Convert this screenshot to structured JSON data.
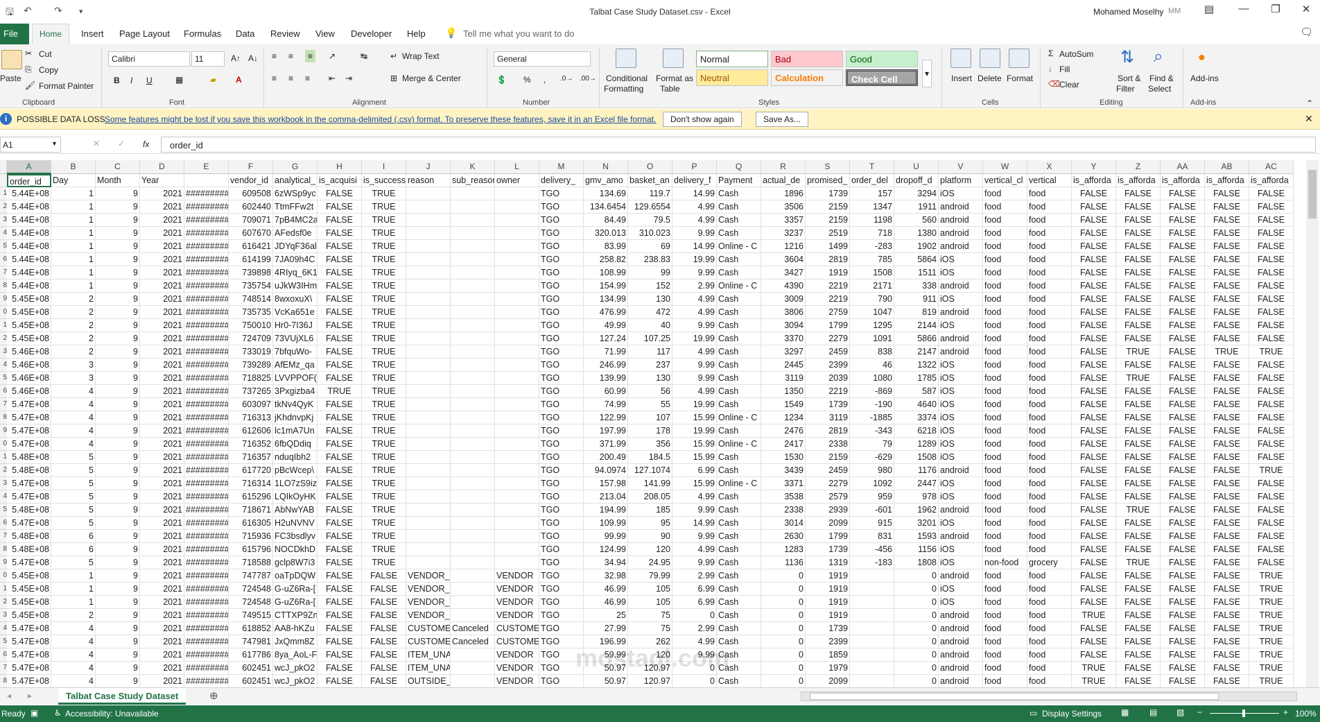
{
  "window": {
    "title": "Talbat Case Study Dataset.csv  -  Excel",
    "user": "Mohamed Moselhy",
    "user_initials": "MM"
  },
  "tabs": [
    "File",
    "Home",
    "Insert",
    "Page Layout",
    "Formulas",
    "Data",
    "Review",
    "View",
    "Developer",
    "Help"
  ],
  "tell_me": "Tell me what you want to do",
  "ribbon": {
    "clipboard": {
      "label": "Clipboard",
      "paste": "Paste",
      "cut": "Cut",
      "copy": "Copy",
      "format_painter": "Format Painter"
    },
    "font": {
      "label": "Font",
      "font_name": "Calibri",
      "font_size": "11"
    },
    "alignment": {
      "label": "Alignment",
      "wrap_text": "Wrap Text",
      "merge_center": "Merge & Center"
    },
    "number": {
      "label": "Number",
      "format": "General"
    },
    "styles": {
      "label": "Styles",
      "conditional": "Conditional",
      "formatting": "Formatting",
      "format_as": "Format as",
      "table": "Table",
      "normal": "Normal",
      "bad": "Bad",
      "good": "Good",
      "neutral": "Neutral",
      "calculation": "Calculation",
      "check_cell": "Check Cell"
    },
    "cells": {
      "label": "Cells",
      "insert": "Insert",
      "delete": "Delete",
      "format": "Format"
    },
    "editing": {
      "label": "Editing",
      "autosum": "AutoSum",
      "fill": "Fill",
      "clear": "Clear",
      "sort_filter": "Sort &",
      "filter": "Filter",
      "find_select": "Find &",
      "select": "Select"
    },
    "addins": {
      "label": "Add-ins",
      "addins": "Add-ins"
    }
  },
  "message_bar": {
    "title": "POSSIBLE DATA LOSS",
    "text": "Some features might be lost if you save this workbook in the comma-delimited (.csv) format. To preserve these features, save it in an Excel file format.",
    "btn_dont_show": "Don't show again",
    "btn_save_as": "Save As..."
  },
  "formula_bar": {
    "name_box": "A1",
    "fx": "fx",
    "content": "order_id"
  },
  "columns": [
    "A",
    "B",
    "C",
    "D",
    "E",
    "F",
    "G",
    "H",
    "I",
    "J",
    "K",
    "L",
    "M",
    "N",
    "O",
    "P",
    "Q",
    "R",
    "S",
    "T",
    "U",
    "V",
    "W",
    "X",
    "Y",
    "Z",
    "AA",
    "AB",
    "AC"
  ],
  "headers": [
    "order_id",
    "Day",
    "Month",
    "Year",
    "",
    "vendor_id",
    "analytical_",
    "is_acquisi",
    "is_success",
    "reason",
    "sub_reason",
    "owner",
    "delivery_",
    "gmv_amo",
    "basket_an",
    "delivery_f",
    "Payment",
    "actual_de",
    "promised_",
    "order_del",
    "dropoff_d",
    "platform",
    "vertical_cl",
    "vertical",
    "is_afforda",
    "is_afforda",
    "is_afforda",
    "is_afforda",
    "is_afforda"
  ],
  "rows": [
    [
      "5.44E+08",
      "1",
      "9",
      "2021",
      "#########",
      "609508",
      "6zWSp9yc",
      "FALSE",
      "TRUE",
      "",
      "",
      "",
      "TGO",
      "134.69",
      "119.7",
      "14.99",
      "Cash",
      "1896",
      "1739",
      "157",
      "3294",
      "iOS",
      "food",
      "food",
      "FALSE",
      "FALSE",
      "FALSE",
      "FALSE",
      "FALSE"
    ],
    [
      "5.44E+08",
      "1",
      "9",
      "2021",
      "#########",
      "602440",
      "TtmFFw2t",
      "FALSE",
      "TRUE",
      "",
      "",
      "",
      "TGO",
      "134.6454",
      "129.6554",
      "4.99",
      "Cash",
      "3506",
      "2159",
      "1347",
      "1911",
      "android",
      "food",
      "food",
      "FALSE",
      "FALSE",
      "FALSE",
      "FALSE",
      "FALSE"
    ],
    [
      "5.44E+08",
      "1",
      "9",
      "2021",
      "#########",
      "709071",
      "7pB4MC2a",
      "FALSE",
      "TRUE",
      "",
      "",
      "",
      "TGO",
      "84.49",
      "79.5",
      "4.99",
      "Cash",
      "3357",
      "2159",
      "1198",
      "560",
      "android",
      "food",
      "food",
      "FALSE",
      "FALSE",
      "FALSE",
      "FALSE",
      "FALSE"
    ],
    [
      "5.44E+08",
      "1",
      "9",
      "2021",
      "#########",
      "607670",
      "AFedsf0e",
      "FALSE",
      "TRUE",
      "",
      "",
      "",
      "TGO",
      "320.013",
      "310.023",
      "9.99",
      "Cash",
      "3237",
      "2519",
      "718",
      "1380",
      "android",
      "food",
      "food",
      "FALSE",
      "FALSE",
      "FALSE",
      "FALSE",
      "FALSE"
    ],
    [
      "5.44E+08",
      "1",
      "9",
      "2021",
      "#########",
      "616421",
      "JDYqF36al",
      "FALSE",
      "TRUE",
      "",
      "",
      "",
      "TGO",
      "83.99",
      "69",
      "14.99",
      "Online - C",
      "1216",
      "1499",
      "-283",
      "1902",
      "android",
      "food",
      "food",
      "FALSE",
      "FALSE",
      "FALSE",
      "FALSE",
      "FALSE"
    ],
    [
      "5.44E+08",
      "1",
      "9",
      "2021",
      "#########",
      "614199",
      "7JA09h4C",
      "FALSE",
      "TRUE",
      "",
      "",
      "",
      "TGO",
      "258.82",
      "238.83",
      "19.99",
      "Cash",
      "3604",
      "2819",
      "785",
      "5864",
      "iOS",
      "food",
      "food",
      "FALSE",
      "FALSE",
      "FALSE",
      "FALSE",
      "FALSE"
    ],
    [
      "5.44E+08",
      "1",
      "9",
      "2021",
      "#########",
      "739898",
      "4RIyq_6K1",
      "FALSE",
      "TRUE",
      "",
      "",
      "",
      "TGO",
      "108.99",
      "99",
      "9.99",
      "Cash",
      "3427",
      "1919",
      "1508",
      "1511",
      "iOS",
      "food",
      "food",
      "FALSE",
      "FALSE",
      "FALSE",
      "FALSE",
      "FALSE"
    ],
    [
      "5.44E+08",
      "1",
      "9",
      "2021",
      "#########",
      "735754",
      "uJkW3IHm",
      "FALSE",
      "TRUE",
      "",
      "",
      "",
      "TGO",
      "154.99",
      "152",
      "2.99",
      "Online - C",
      "4390",
      "2219",
      "2171",
      "338",
      "android",
      "food",
      "food",
      "FALSE",
      "FALSE",
      "FALSE",
      "FALSE",
      "FALSE"
    ],
    [
      "5.45E+08",
      "2",
      "9",
      "2021",
      "#########",
      "748514",
      "8wxoxuX\\",
      "FALSE",
      "TRUE",
      "",
      "",
      "",
      "TGO",
      "134.99",
      "130",
      "4.99",
      "Cash",
      "3009",
      "2219",
      "790",
      "911",
      "iOS",
      "food",
      "food",
      "FALSE",
      "FALSE",
      "FALSE",
      "FALSE",
      "FALSE"
    ],
    [
      "5.45E+08",
      "2",
      "9",
      "2021",
      "#########",
      "735735",
      "VcKa651e",
      "FALSE",
      "TRUE",
      "",
      "",
      "",
      "TGO",
      "476.99",
      "472",
      "4.99",
      "Cash",
      "3806",
      "2759",
      "1047",
      "819",
      "android",
      "food",
      "food",
      "FALSE",
      "FALSE",
      "FALSE",
      "FALSE",
      "FALSE"
    ],
    [
      "5.45E+08",
      "2",
      "9",
      "2021",
      "#########",
      "750010",
      "Hr0-7I36J",
      "FALSE",
      "TRUE",
      "",
      "",
      "",
      "TGO",
      "49.99",
      "40",
      "9.99",
      "Cash",
      "3094",
      "1799",
      "1295",
      "2144",
      "iOS",
      "food",
      "food",
      "FALSE",
      "FALSE",
      "FALSE",
      "FALSE",
      "FALSE"
    ],
    [
      "5.45E+08",
      "2",
      "9",
      "2021",
      "#########",
      "724709",
      "73VUjXL6",
      "FALSE",
      "TRUE",
      "",
      "",
      "",
      "TGO",
      "127.24",
      "107.25",
      "19.99",
      "Cash",
      "3370",
      "2279",
      "1091",
      "5866",
      "android",
      "food",
      "food",
      "FALSE",
      "FALSE",
      "FALSE",
      "FALSE",
      "FALSE"
    ],
    [
      "5.46E+08",
      "2",
      "9",
      "2021",
      "#########",
      "733019",
      "7bfquWo-",
      "FALSE",
      "TRUE",
      "",
      "",
      "",
      "TGO",
      "71.99",
      "117",
      "4.99",
      "Cash",
      "3297",
      "2459",
      "838",
      "2147",
      "android",
      "food",
      "food",
      "FALSE",
      "TRUE",
      "FALSE",
      "TRUE",
      "TRUE"
    ],
    [
      "5.46E+08",
      "3",
      "9",
      "2021",
      "#########",
      "739289",
      "AfEMz_qa",
      "FALSE",
      "TRUE",
      "",
      "",
      "",
      "TGO",
      "246.99",
      "237",
      "9.99",
      "Cash",
      "2445",
      "2399",
      "46",
      "1322",
      "iOS",
      "food",
      "food",
      "FALSE",
      "FALSE",
      "FALSE",
      "FALSE",
      "FALSE"
    ],
    [
      "5.46E+08",
      "3",
      "9",
      "2021",
      "#########",
      "718825",
      "LVVPPOF(",
      "FALSE",
      "TRUE",
      "",
      "",
      "",
      "TGO",
      "139.99",
      "130",
      "9.99",
      "Cash",
      "3119",
      "2039",
      "1080",
      "1785",
      "iOS",
      "food",
      "food",
      "FALSE",
      "TRUE",
      "FALSE",
      "FALSE",
      "FALSE"
    ],
    [
      "5.46E+08",
      "4",
      "9",
      "2021",
      "#########",
      "737265",
      "3Pxgizba4",
      "TRUE",
      "TRUE",
      "",
      "",
      "",
      "TGO",
      "60.99",
      "56",
      "4.99",
      "Cash",
      "1350",
      "2219",
      "-869",
      "587",
      "iOS",
      "food",
      "food",
      "FALSE",
      "FALSE",
      "FALSE",
      "FALSE",
      "FALSE"
    ],
    [
      "5.47E+08",
      "4",
      "9",
      "2021",
      "#########",
      "603097",
      "tkNv4QyK",
      "FALSE",
      "TRUE",
      "",
      "",
      "",
      "TGO",
      "74.99",
      "55",
      "19.99",
      "Cash",
      "1549",
      "1739",
      "-190",
      "4640",
      "iOS",
      "food",
      "food",
      "FALSE",
      "FALSE",
      "FALSE",
      "FALSE",
      "FALSE"
    ],
    [
      "5.47E+08",
      "4",
      "9",
      "2021",
      "#########",
      "716313",
      "jKhdnvpKj",
      "FALSE",
      "TRUE",
      "",
      "",
      "",
      "TGO",
      "122.99",
      "107",
      "15.99",
      "Online - C",
      "1234",
      "3119",
      "-1885",
      "3374",
      "iOS",
      "food",
      "food",
      "FALSE",
      "FALSE",
      "FALSE",
      "FALSE",
      "FALSE"
    ],
    [
      "5.47E+08",
      "4",
      "9",
      "2021",
      "#########",
      "612606",
      "lc1mA7Un",
      "FALSE",
      "TRUE",
      "",
      "",
      "",
      "TGO",
      "197.99",
      "178",
      "19.99",
      "Cash",
      "2476",
      "2819",
      "-343",
      "6218",
      "iOS",
      "food",
      "food",
      "FALSE",
      "FALSE",
      "FALSE",
      "FALSE",
      "FALSE"
    ],
    [
      "5.47E+08",
      "4",
      "9",
      "2021",
      "#########",
      "716352",
      "6fbQDdiq",
      "FALSE",
      "TRUE",
      "",
      "",
      "",
      "TGO",
      "371.99",
      "356",
      "15.99",
      "Online - C",
      "2417",
      "2338",
      "79",
      "1289",
      "iOS",
      "food",
      "food",
      "FALSE",
      "FALSE",
      "FALSE",
      "FALSE",
      "FALSE"
    ],
    [
      "5.48E+08",
      "5",
      "9",
      "2021",
      "#########",
      "716357",
      "nduqIbh2",
      "FALSE",
      "TRUE",
      "",
      "",
      "",
      "TGO",
      "200.49",
      "184.5",
      "15.99",
      "Cash",
      "1530",
      "2159",
      "-629",
      "1508",
      "iOS",
      "food",
      "food",
      "FALSE",
      "FALSE",
      "FALSE",
      "FALSE",
      "FALSE"
    ],
    [
      "5.48E+08",
      "5",
      "9",
      "2021",
      "#########",
      "617720",
      "pBcWcep\\",
      "FALSE",
      "TRUE",
      "",
      "",
      "",
      "TGO",
      "94.0974",
      "127.1074",
      "6.99",
      "Cash",
      "3439",
      "2459",
      "980",
      "1176",
      "android",
      "food",
      "food",
      "FALSE",
      "FALSE",
      "FALSE",
      "FALSE",
      "TRUE"
    ],
    [
      "5.47E+08",
      "5",
      "9",
      "2021",
      "#########",
      "716314",
      "1LO7zS9iz",
      "FALSE",
      "TRUE",
      "",
      "",
      "",
      "TGO",
      "157.98",
      "141.99",
      "15.99",
      "Online - C",
      "3371",
      "2279",
      "1092",
      "2447",
      "iOS",
      "food",
      "food",
      "FALSE",
      "FALSE",
      "FALSE",
      "FALSE",
      "FALSE"
    ],
    [
      "5.47E+08",
      "5",
      "9",
      "2021",
      "#########",
      "615296",
      "LQIkOyHK",
      "FALSE",
      "TRUE",
      "",
      "",
      "",
      "TGO",
      "213.04",
      "208.05",
      "4.99",
      "Cash",
      "3538",
      "2579",
      "959",
      "978",
      "iOS",
      "food",
      "food",
      "FALSE",
      "FALSE",
      "FALSE",
      "FALSE",
      "FALSE"
    ],
    [
      "5.48E+08",
      "5",
      "9",
      "2021",
      "#########",
      "718671",
      "AbNwYAB",
      "FALSE",
      "TRUE",
      "",
      "",
      "",
      "TGO",
      "194.99",
      "185",
      "9.99",
      "Cash",
      "2338",
      "2939",
      "-601",
      "1962",
      "android",
      "food",
      "food",
      "FALSE",
      "TRUE",
      "FALSE",
      "FALSE",
      "FALSE"
    ],
    [
      "5.47E+08",
      "5",
      "9",
      "2021",
      "#########",
      "616305",
      "H2uNVNV",
      "FALSE",
      "TRUE",
      "",
      "",
      "",
      "TGO",
      "109.99",
      "95",
      "14.99",
      "Cash",
      "3014",
      "2099",
      "915",
      "3201",
      "iOS",
      "food",
      "food",
      "FALSE",
      "FALSE",
      "FALSE",
      "FALSE",
      "FALSE"
    ],
    [
      "5.48E+08",
      "6",
      "9",
      "2021",
      "#########",
      "715936",
      "FC3bsdlyv",
      "FALSE",
      "TRUE",
      "",
      "",
      "",
      "TGO",
      "99.99",
      "90",
      "9.99",
      "Cash",
      "2630",
      "1799",
      "831",
      "1593",
      "android",
      "food",
      "food",
      "FALSE",
      "FALSE",
      "FALSE",
      "FALSE",
      "FALSE"
    ],
    [
      "5.48E+08",
      "6",
      "9",
      "2021",
      "#########",
      "615796",
      "NOCDkhD",
      "FALSE",
      "TRUE",
      "",
      "",
      "",
      "TGO",
      "124.99",
      "120",
      "4.99",
      "Cash",
      "1283",
      "1739",
      "-456",
      "1156",
      "iOS",
      "food",
      "food",
      "FALSE",
      "FALSE",
      "FALSE",
      "FALSE",
      "FALSE"
    ],
    [
      "5.47E+08",
      "5",
      "9",
      "2021",
      "#########",
      "718588",
      "gclp8W7i3",
      "FALSE",
      "TRUE",
      "",
      "",
      "",
      "TGO",
      "34.94",
      "24.95",
      "9.99",
      "Cash",
      "1136",
      "1319",
      "-183",
      "1808",
      "iOS",
      "non-food",
      "grocery",
      "FALSE",
      "TRUE",
      "FALSE",
      "FALSE",
      "FALSE"
    ],
    [
      "5.45E+08",
      "1",
      "9",
      "2021",
      "#########",
      "747787",
      "oaTpDQW",
      "FALSE",
      "FALSE",
      "VENDOR_UNREACHA",
      "",
      "VENDOR",
      "TGO",
      "32.98",
      "79.99",
      "2.99",
      "Cash",
      "0",
      "1919",
      "",
      "0",
      "android",
      "food",
      "food",
      "FALSE",
      "FALSE",
      "FALSE",
      "FALSE",
      "TRUE"
    ],
    [
      "5.45E+08",
      "1",
      "9",
      "2021",
      "#########",
      "724548",
      "G-uZ6Ra-[",
      "FALSE",
      "FALSE",
      "VENDOR_TOO_BUSY",
      "",
      "VENDOR",
      "TGO",
      "46.99",
      "105",
      "6.99",
      "Cash",
      "0",
      "1919",
      "",
      "0",
      "iOS",
      "food",
      "food",
      "FALSE",
      "FALSE",
      "FALSE",
      "FALSE",
      "TRUE"
    ],
    [
      "5.45E+08",
      "1",
      "9",
      "2021",
      "#########",
      "724548",
      "G-uZ6Ra-[",
      "FALSE",
      "FALSE",
      "VENDOR_TOO_BUSY",
      "",
      "VENDOR",
      "TGO",
      "46.99",
      "105",
      "6.99",
      "Cash",
      "0",
      "1919",
      "",
      "0",
      "iOS",
      "food",
      "food",
      "FALSE",
      "FALSE",
      "FALSE",
      "FALSE",
      "TRUE"
    ],
    [
      "5.45E+08",
      "2",
      "9",
      "2021",
      "#########",
      "749515",
      "CTTXP9Zn",
      "FALSE",
      "FALSE",
      "VENDOR_NO_RESPO",
      "",
      "VENDOR",
      "TGO",
      "25",
      "75",
      "0",
      "Cash",
      "0",
      "1919",
      "",
      "0",
      "android",
      "food",
      "food",
      "TRUE",
      "FALSE",
      "FALSE",
      "FALSE",
      "TRUE"
    ],
    [
      "5.47E+08",
      "4",
      "9",
      "2021",
      "#########",
      "618852",
      "AA8-hKZu",
      "FALSE",
      "FALSE",
      "CUSTOME",
      "Canceled",
      "CUSTOME",
      "TGO",
      "27.99",
      "75",
      "2.99",
      "Cash",
      "0",
      "1739",
      "",
      "0",
      "android",
      "food",
      "food",
      "FALSE",
      "FALSE",
      "FALSE",
      "FALSE",
      "TRUE"
    ],
    [
      "5.47E+08",
      "4",
      "9",
      "2021",
      "#########",
      "747981",
      "JxQmm8Z",
      "FALSE",
      "FALSE",
      "CUSTOME",
      "Canceled",
      "CUSTOME",
      "TGO",
      "196.99",
      "262",
      "4.99",
      "Cash",
      "0",
      "2399",
      "",
      "0",
      "android",
      "food",
      "food",
      "FALSE",
      "FALSE",
      "FALSE",
      "FALSE",
      "TRUE"
    ],
    [
      "5.47E+08",
      "4",
      "9",
      "2021",
      "#########",
      "617786",
      "8ya_AoL-F",
      "FALSE",
      "FALSE",
      "ITEM_UNAVAILABLE",
      "",
      "VENDOR",
      "TGO",
      "59.99",
      "120",
      "9.99",
      "Cash",
      "0",
      "1859",
      "",
      "0",
      "android",
      "food",
      "food",
      "FALSE",
      "FALSE",
      "FALSE",
      "FALSE",
      "TRUE"
    ],
    [
      "5.47E+08",
      "4",
      "9",
      "2021",
      "#########",
      "602451",
      "wcJ_pkO2",
      "FALSE",
      "FALSE",
      "ITEM_UNAVAILABLE",
      "",
      "VENDOR",
      "TGO",
      "50.97",
      "120.97",
      "0",
      "Cash",
      "0",
      "1979",
      "",
      "0",
      "android",
      "food",
      "food",
      "TRUE",
      "FALSE",
      "FALSE",
      "FALSE",
      "TRUE"
    ],
    [
      "5.47E+08",
      "4",
      "9",
      "2021",
      "#########",
      "602451",
      "wcJ_pkO2",
      "FALSE",
      "FALSE",
      "OUTSIDE_DELIVERY",
      "",
      "VENDOR",
      "TGO",
      "50.97",
      "120.97",
      "0",
      "Cash",
      "0",
      "2099",
      "",
      "0",
      "android",
      "food",
      "food",
      "TRUE",
      "FALSE",
      "FALSE",
      "FALSE",
      "TRUE"
    ]
  ],
  "row_labels": [
    "",
    "1",
    "2",
    "3",
    "4",
    "5",
    "6",
    "7",
    "8",
    "9",
    "0",
    "1",
    "2",
    "3",
    "4",
    "5",
    "6",
    "7",
    "8",
    "9",
    "0",
    "1",
    "2",
    "3",
    "4",
    "5",
    "6",
    "7",
    "8",
    "9",
    "0",
    "1",
    "2",
    "3",
    "4",
    "5",
    "6",
    "7",
    "8",
    "9"
  ],
  "sheet": {
    "tab_name": "Talbat Case Study Dataset"
  },
  "status": {
    "ready": "Ready",
    "accessibility": "Accessibility: Unavailable",
    "display_settings": "Display Settings",
    "zoom": "100%"
  },
  "watermark": "mostaql.com"
}
